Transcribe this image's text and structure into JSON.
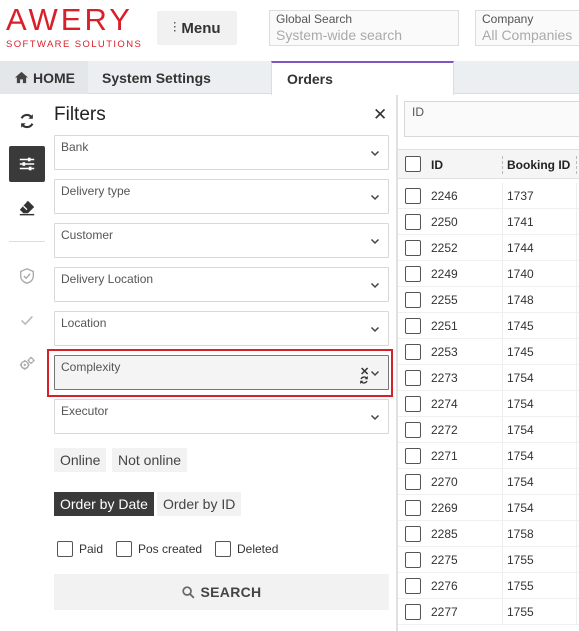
{
  "brand": {
    "name": "AWERY",
    "tagline": "SOFTWARE SOLUTIONS",
    "color": "#d9202a"
  },
  "header": {
    "menu_label": "Menu",
    "global_search": {
      "label": "Global Search",
      "placeholder": "System-wide search"
    },
    "company": {
      "label": "Company",
      "value": "All Companies"
    }
  },
  "tabs": [
    {
      "label": "HOME",
      "icon": "home-icon"
    },
    {
      "label": "System Settings"
    },
    {
      "label": "Orders",
      "active": true
    }
  ],
  "rail": {
    "icons": [
      "refresh-icon",
      "sliders-icon",
      "eraser-icon",
      "shield-check-icon",
      "check-icon",
      "gears-icon"
    ],
    "active": "sliders-icon"
  },
  "filters": {
    "title": "Filters",
    "close_icon": "close-icon",
    "fields": [
      {
        "label": "Bank"
      },
      {
        "label": "Delivery type"
      },
      {
        "label": "Customer"
      },
      {
        "label": "Delivery Location"
      },
      {
        "label": "Location"
      },
      {
        "label": "Complexity",
        "highlighted": true
      },
      {
        "label": "Executor"
      }
    ],
    "online_toggle": [
      "Online",
      "Not online"
    ],
    "order_toggle": {
      "options": [
        "Order by Date",
        "Order by ID"
      ],
      "selected": "Order by Date"
    },
    "checks": [
      "Paid",
      "Pos created",
      "Deleted"
    ],
    "search_label": "SEARCH"
  },
  "grid": {
    "id_filter_label": "ID",
    "columns": [
      "ID",
      "Booking ID"
    ],
    "rows": [
      [
        "2246",
        "1737"
      ],
      [
        "2250",
        "1741"
      ],
      [
        "2252",
        "1744"
      ],
      [
        "2249",
        "1740"
      ],
      [
        "2255",
        "1748"
      ],
      [
        "2251",
        "1745"
      ],
      [
        "2253",
        "1745"
      ],
      [
        "2273",
        "1754"
      ],
      [
        "2274",
        "1754"
      ],
      [
        "2272",
        "1754"
      ],
      [
        "2271",
        "1754"
      ],
      [
        "2270",
        "1754"
      ],
      [
        "2269",
        "1754"
      ],
      [
        "2285",
        "1758"
      ],
      [
        "2275",
        "1755"
      ],
      [
        "2276",
        "1755"
      ],
      [
        "2277",
        "1755"
      ]
    ]
  }
}
